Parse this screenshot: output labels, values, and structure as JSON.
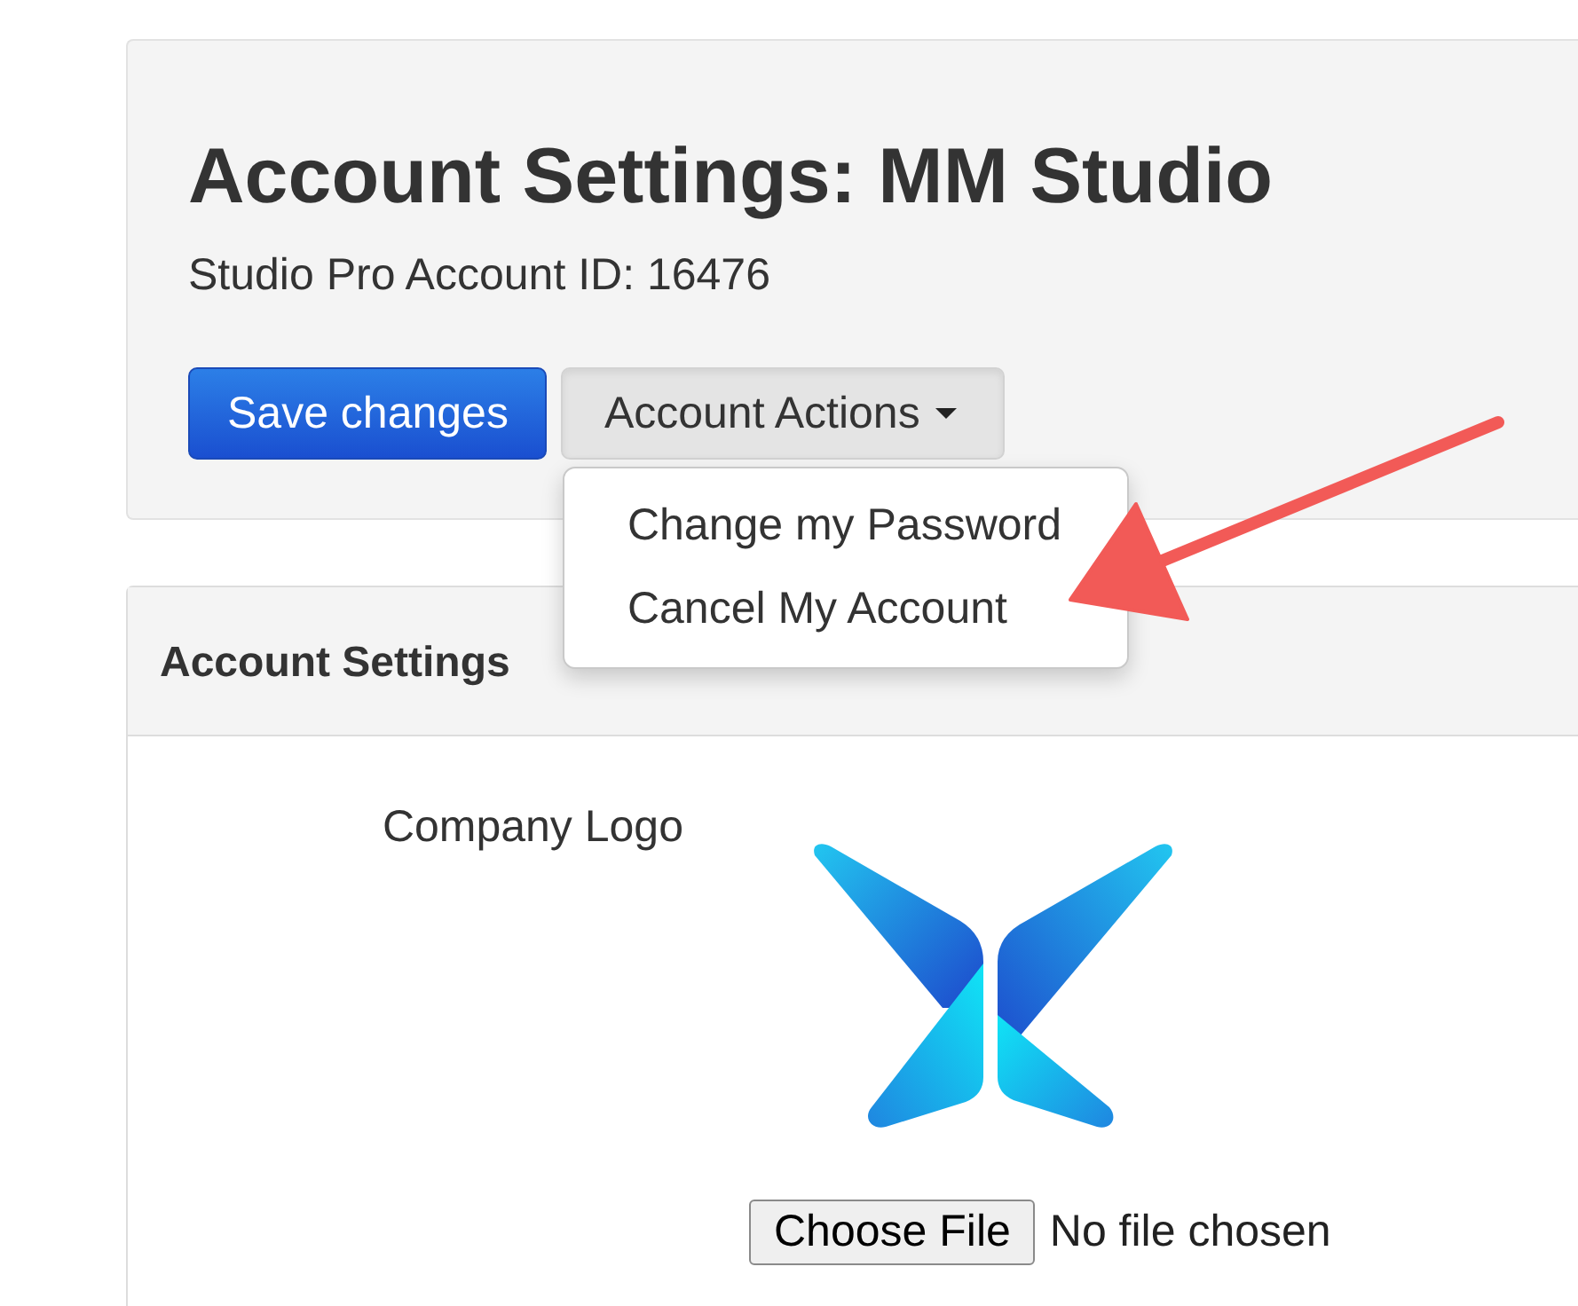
{
  "header": {
    "title": "Account Settings: MM Studio",
    "subtitle": "Studio Pro Account ID: 16476",
    "buttons": [
      {
        "label": "Save changes",
        "kind": "primary"
      },
      {
        "label": "Account Actions",
        "kind": "dropdown",
        "expanded": true
      }
    ]
  },
  "dropdown_menu": {
    "items": [
      {
        "label": "Change my Password"
      },
      {
        "label": "Cancel My Account"
      }
    ]
  },
  "settings_panel": {
    "heading": "Account Settings",
    "fields": [
      {
        "label": "Company Logo",
        "kind": "logo_upload",
        "file_button": "Choose File",
        "file_status": "No file chosen"
      }
    ]
  }
}
